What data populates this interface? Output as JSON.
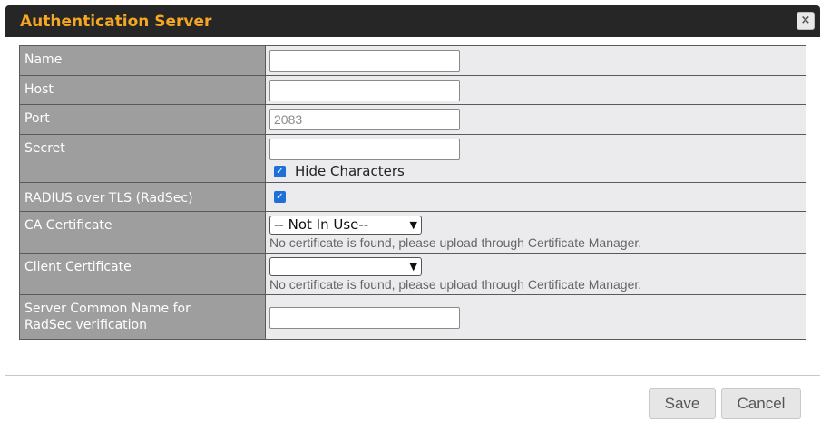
{
  "dialog": {
    "title": "Authentication Server",
    "close_icon": "×"
  },
  "form": {
    "name": {
      "label": "Name",
      "value": ""
    },
    "host": {
      "label": "Host",
      "value": ""
    },
    "port": {
      "label": "Port",
      "placeholder": "2083"
    },
    "secret": {
      "label": "Secret",
      "value": "",
      "hide_characters_label": "Hide Characters",
      "hide_characters_checked": true
    },
    "radsec": {
      "label": "RADIUS over TLS (RadSec)",
      "checked": true
    },
    "ca_certificate": {
      "label": "CA Certificate",
      "selected": "-- Not In Use--",
      "hint": "No certificate is found, please upload through Certificate Manager."
    },
    "client_certificate": {
      "label": "Client Certificate",
      "selected": "",
      "hint": "No certificate is found, please upload through Certificate Manager."
    },
    "server_common_name": {
      "label_line1": "Server Common Name for",
      "label_line2": "RadSec verification",
      "value": ""
    }
  },
  "buttons": {
    "save": "Save",
    "cancel": "Cancel"
  },
  "colors": {
    "title": "#f5a623",
    "titlebar_bg": "#262626",
    "label_bg": "#9e9e9e",
    "value_bg": "#ebebed",
    "checkbox": "#1f6fd8"
  }
}
